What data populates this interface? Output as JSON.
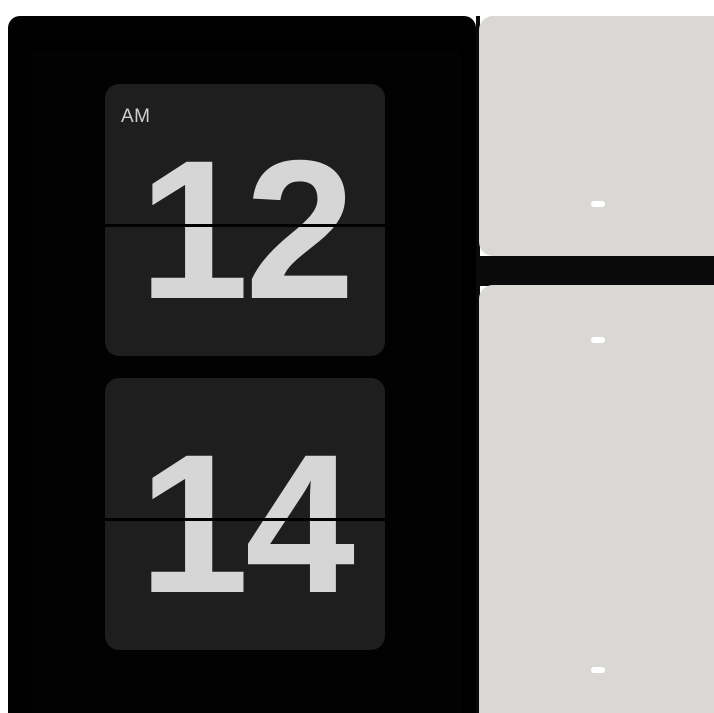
{
  "clock": {
    "period": "AM",
    "hours": "12",
    "minutes": "14"
  },
  "side_panels": {
    "top": {
      "handles": 1
    },
    "bottom": {
      "handles": 2
    }
  },
  "colors": {
    "clock_background": "#000000",
    "flip_card": "#1e1e1e",
    "digit": "#d6d6d6",
    "panel": "#d9d8d5",
    "handle": "#ffffff"
  }
}
